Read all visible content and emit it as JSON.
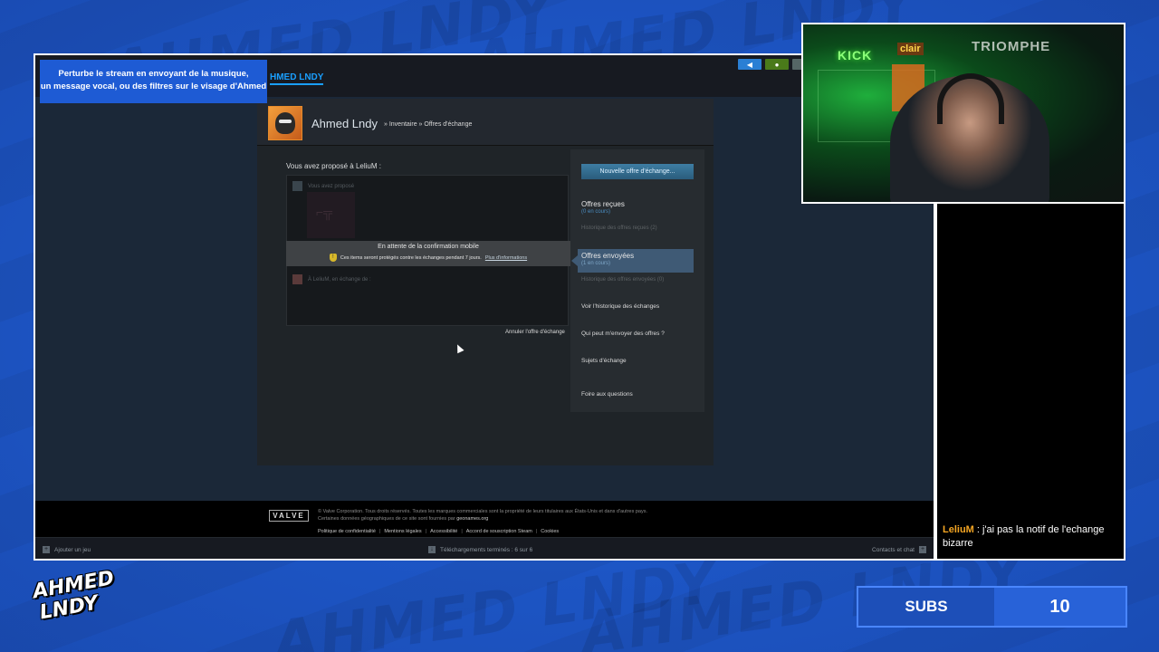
{
  "overlay": {
    "notice_line1": "Perturbe le stream en envoyant de la musique,",
    "notice_line2": "un message vocal, ou des filtres sur le visage d'Ahmed",
    "bg_word": "AHMED LNDY",
    "webcam_signs": {
      "kick": "KICK",
      "clair": "clair",
      "triomphe": "TRIOMPHE"
    },
    "logo_line1": "AHMED",
    "logo_line2": "LNDY",
    "subs_label": "SUBS",
    "subs_value": "10",
    "chat": {
      "user": "LeliuM",
      "message": " : j'ai pas la notif de l'echange bizarre"
    }
  },
  "steam": {
    "username": "HMED LNDY",
    "profile": {
      "name": "Ahmed Lndy",
      "crumb_sep": " » ",
      "crumb_inventory": "Inventaire",
      "crumb_offers": "Offres d'échange"
    },
    "trade": {
      "title": "Vous avez proposé à LeliuM :",
      "you_proposed": "Vous avez proposé",
      "pending_title": "En attente de la confirmation mobile",
      "pending_text": "Ces items seront protégés contre les échanges pendant 7 jours.",
      "pending_link": "Plus d'informations",
      "to_lelium": "À LeliuM, en échange de :",
      "cancel": "Annuler l'offre d'échange"
    },
    "sidebar": {
      "new_offer": "Nouvelle offre d'échange...",
      "received_title": "Offres reçues",
      "received_count": "(0 en cours)",
      "received_history": "Historique des offres reçues (2)",
      "sent_title": "Offres envoyées",
      "sent_count": "(1 en cours)",
      "sent_history": "Historique des offres envoyées (0)",
      "history": "Voir l'historique des échanges",
      "who": "Qui peut m'envoyer des offres ?",
      "topics": "Sujets d'échange",
      "faq": "Foire aux questions"
    },
    "footer": {
      "valve": "VALVE",
      "copyright": "© Valve Corporation. Tous droits réservés. Toutes les marques commerciales sont la propriété de leurs titulaires aux États-Unis et dans d'autres pays.",
      "geo": "Certaines données géographiques de ce site sont fournies par",
      "geo_site": "geonames.org",
      "links": [
        "Politique de confidentialité",
        "Mentions légales",
        "Accessibilité",
        "Accord de souscription Steam",
        "Cookies"
      ]
    },
    "statusbar": {
      "add_game": "Ajouter un jeu",
      "downloads": "Téléchargements terminés : 6 sur 6",
      "friends": "Contacts et chat"
    }
  }
}
